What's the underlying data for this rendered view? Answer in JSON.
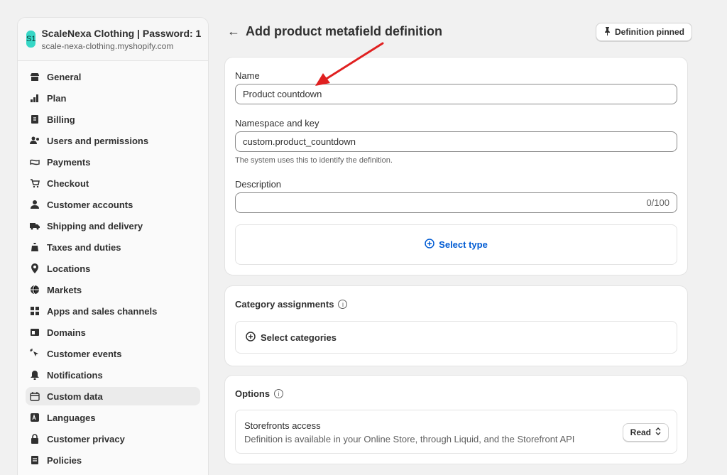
{
  "store": {
    "avatar": "S1",
    "name": "ScaleNexa Clothing | Password: 1",
    "url": "scale-nexa-clothing.myshopify.com"
  },
  "sidebar": {
    "items": [
      {
        "label": "General",
        "icon": "store-icon"
      },
      {
        "label": "Plan",
        "icon": "plan-icon"
      },
      {
        "label": "Billing",
        "icon": "billing-icon"
      },
      {
        "label": "Users and permissions",
        "icon": "users-icon"
      },
      {
        "label": "Payments",
        "icon": "payments-icon"
      },
      {
        "label": "Checkout",
        "icon": "cart-icon"
      },
      {
        "label": "Customer accounts",
        "icon": "person-icon"
      },
      {
        "label": "Shipping and delivery",
        "icon": "truck-icon"
      },
      {
        "label": "Taxes and duties",
        "icon": "tax-icon"
      },
      {
        "label": "Locations",
        "icon": "location-icon"
      },
      {
        "label": "Markets",
        "icon": "globe-icon"
      },
      {
        "label": "Apps and sales channels",
        "icon": "apps-icon"
      },
      {
        "label": "Domains",
        "icon": "domain-icon"
      },
      {
        "label": "Customer events",
        "icon": "cursor-icon"
      },
      {
        "label": "Notifications",
        "icon": "bell-icon"
      },
      {
        "label": "Custom data",
        "icon": "custom-data-icon",
        "active": true
      },
      {
        "label": "Languages",
        "icon": "language-icon"
      },
      {
        "label": "Customer privacy",
        "icon": "lock-icon"
      },
      {
        "label": "Policies",
        "icon": "policy-icon"
      }
    ]
  },
  "header": {
    "back": "←",
    "title": "Add product metafield definition",
    "pin_label": "Definition pinned"
  },
  "form": {
    "name_label": "Name",
    "name_value": "Product countdown",
    "namespace_label": "Namespace and key",
    "namespace_value": "custom.product_countdown",
    "namespace_help": "The system uses this to identify the definition.",
    "description_label": "Description",
    "description_value": "",
    "description_counter": "0/100",
    "select_type": "Select type"
  },
  "category": {
    "title": "Category assignments",
    "info": "i",
    "select_label": "Select categories"
  },
  "options": {
    "title": "Options",
    "info": "i",
    "storefront_title": "Storefronts access",
    "storefront_desc": "Definition is available in your Online Store, through Liquid, and the Storefront API",
    "read_label": "Read"
  },
  "colors": {
    "accent": "#005bd3",
    "annotation_arrow": "#e02020",
    "store_avatar": "#36d7c6"
  }
}
